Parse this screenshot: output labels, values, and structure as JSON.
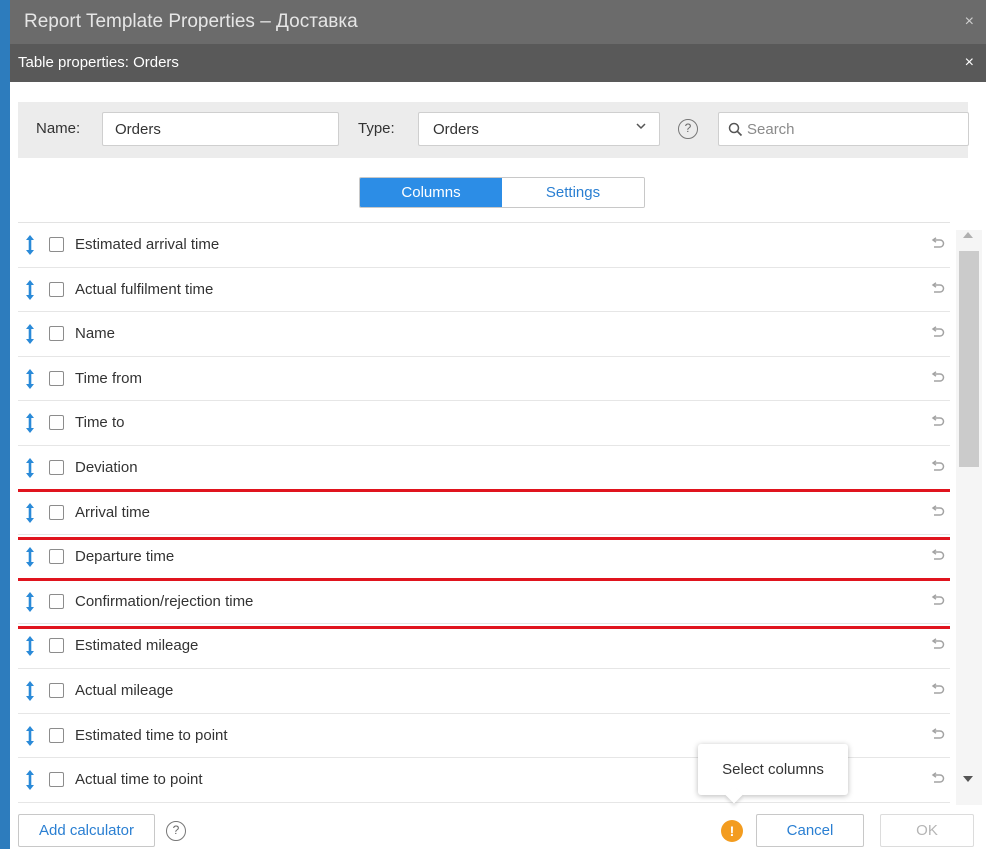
{
  "window": {
    "title": "Report Template Properties – Доставка",
    "close_glyph": "×"
  },
  "dialog": {
    "title": "Table properties: Orders",
    "close_glyph": "×"
  },
  "form": {
    "name_label": "Name:",
    "name_value": "Orders",
    "type_label": "Type:",
    "type_value": "Orders",
    "help_glyph": "?",
    "search_placeholder": "Search"
  },
  "tabs": [
    {
      "label": "Columns",
      "active": true
    },
    {
      "label": "Settings",
      "active": false
    }
  ],
  "columns": [
    {
      "label": "Estimated arrival time",
      "checked": false,
      "highlighted": false
    },
    {
      "label": "Actual fulfilment time",
      "checked": false,
      "highlighted": false
    },
    {
      "label": "Name",
      "checked": false,
      "highlighted": false
    },
    {
      "label": "Time from",
      "checked": false,
      "highlighted": false
    },
    {
      "label": "Time to",
      "checked": false,
      "highlighted": false
    },
    {
      "label": "Deviation",
      "checked": false,
      "highlighted": false
    },
    {
      "label": "Arrival time",
      "checked": false,
      "highlighted": true
    },
    {
      "label": "Departure time",
      "checked": false,
      "highlighted": false
    },
    {
      "label": "Confirmation/rejection time",
      "checked": false,
      "highlighted": true
    },
    {
      "label": "Estimated mileage",
      "checked": false,
      "highlighted": false
    },
    {
      "label": "Actual mileage",
      "checked": false,
      "highlighted": false
    },
    {
      "label": "Estimated time to point",
      "checked": false,
      "highlighted": false
    },
    {
      "label": "Actual time to point",
      "checked": false,
      "highlighted": false
    }
  ],
  "footer": {
    "add_calculator_label": "Add calculator",
    "help_glyph": "?",
    "warning_glyph": "!",
    "cancel_label": "Cancel",
    "ok_label": "OK"
  },
  "tooltip": {
    "text": "Select columns"
  },
  "colors": {
    "accent": "#2c8de6",
    "drag_icon": "#2a8ad8",
    "highlight_border": "#e0141e",
    "warning": "#f39c1f",
    "titlebar_outer": "#6b6b6b",
    "titlebar_inner": "#595959"
  },
  "icons": {
    "drag": "vertical-double-arrow-icon",
    "reset": "undo-arrow-icon",
    "search": "magnifier-icon",
    "select_chevron": "chevron-down-icon"
  }
}
